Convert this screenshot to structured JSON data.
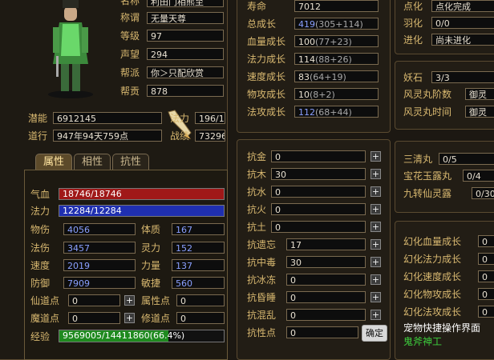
{
  "character": {
    "fields": [
      {
        "label": "名称",
        "value": "利田门相熊至"
      },
      {
        "label": "称谓",
        "value": "无量天尊"
      },
      {
        "label": "等级",
        "value": "97"
      },
      {
        "label": "声望",
        "value": "294"
      },
      {
        "label": "帮派",
        "value": "你＞只配欣赏"
      },
      {
        "label": "帮贡",
        "value": "878"
      }
    ],
    "potential_label": "潜能",
    "potential": "6912145",
    "daoxing_label": "道行",
    "daoxing": "947年94天759点",
    "fali_label": "法力",
    "fali": "196/1",
    "zhanli_label": "战绩",
    "zhanli": "73296"
  },
  "tabs": [
    "属性",
    "相性",
    "抗性"
  ],
  "attributes": {
    "hp_label": "气血",
    "hp": "18746/18746",
    "hp_fill": 1.0,
    "mp_label": "法力",
    "mp": "12284/12284",
    "mp_fill": 1.0,
    "grid": [
      {
        "l1": "物伤",
        "v1": "4056",
        "l2": "体质",
        "v2": "167"
      },
      {
        "l1": "法伤",
        "v1": "3457",
        "l2": "灵力",
        "v2": "152"
      },
      {
        "l1": "速度",
        "v1": "2019",
        "l2": "力量",
        "v2": "137"
      },
      {
        "l1": "防御",
        "v1": "7909",
        "l2": "敏捷",
        "v2": "560"
      }
    ],
    "xiandao_label": "仙道点",
    "xiandao": "0",
    "shuxing_label": "属性点",
    "shuxing": "0",
    "modao_label": "魔道点",
    "modao": "0",
    "xiudao_label": "修道点",
    "xiudao": "0",
    "exp_label": "经验",
    "exp": "9569005/14411860(66.4%)",
    "exp_fill": 0.664
  },
  "pet": {
    "growth": [
      {
        "label": "寿命",
        "value": "7012",
        "blue": false
      },
      {
        "label": "总成长",
        "value": "419",
        "extra": "(305+114)",
        "blue": true
      },
      {
        "label": "血量成长",
        "value": "100",
        "extra": "(77+23)",
        "blue": false
      },
      {
        "label": "法力成长",
        "value": "114",
        "extra": "(88+26)",
        "blue": false
      },
      {
        "label": "速度成长",
        "value": "83",
        "extra": "(64+19)",
        "blue": false
      },
      {
        "label": "物攻成长",
        "value": "10",
        "extra": "(8+2)",
        "blue": false
      },
      {
        "label": "法攻成长",
        "value": "112",
        "extra": "(68+44)",
        "blue": true
      }
    ],
    "resist": [
      {
        "label": "抗金",
        "value": "0"
      },
      {
        "label": "抗木",
        "value": "30"
      },
      {
        "label": "抗水",
        "value": "0"
      },
      {
        "label": "抗火",
        "value": "0"
      },
      {
        "label": "抗土",
        "value": "0"
      },
      {
        "label": "抗遗忘",
        "value": "17"
      },
      {
        "label": "抗中毒",
        "value": "30"
      },
      {
        "label": "抗冰冻",
        "value": "0"
      },
      {
        "label": "抗昏睡",
        "value": "0"
      },
      {
        "label": "抗混乱",
        "value": "0"
      }
    ],
    "resist_points_label": "抗性点",
    "resist_points": "0",
    "confirm": "确定"
  },
  "right": {
    "top": [
      {
        "label": "点化",
        "value": "点化完成"
      },
      {
        "label": "羽化",
        "value": "0/0"
      },
      {
        "label": "进化",
        "value": "尚未进化"
      }
    ],
    "yao": [
      {
        "label": "妖石",
        "value": "3/3"
      },
      {
        "label": "风灵丸阶数",
        "value": "御灵"
      },
      {
        "label": "风灵丸时间",
        "value": "御灵"
      }
    ],
    "pills": [
      {
        "label": "三清丸",
        "value": "0/5"
      },
      {
        "label": "宝花玉露丸",
        "value": "0/4"
      },
      {
        "label": "九转仙灵露",
        "value": "0/30"
      }
    ],
    "huanhua": [
      {
        "label": "幻化血量成长",
        "value": "0"
      },
      {
        "label": "幻化法力成长",
        "value": "0"
      },
      {
        "label": "幻化速度成长",
        "value": "0"
      },
      {
        "label": "幻化物攻成长",
        "value": "0"
      },
      {
        "label": "幻化法攻成长",
        "value": "0"
      }
    ],
    "quick_text": "宠物快捷操作界面",
    "shenji_text": "鬼斧神工"
  }
}
